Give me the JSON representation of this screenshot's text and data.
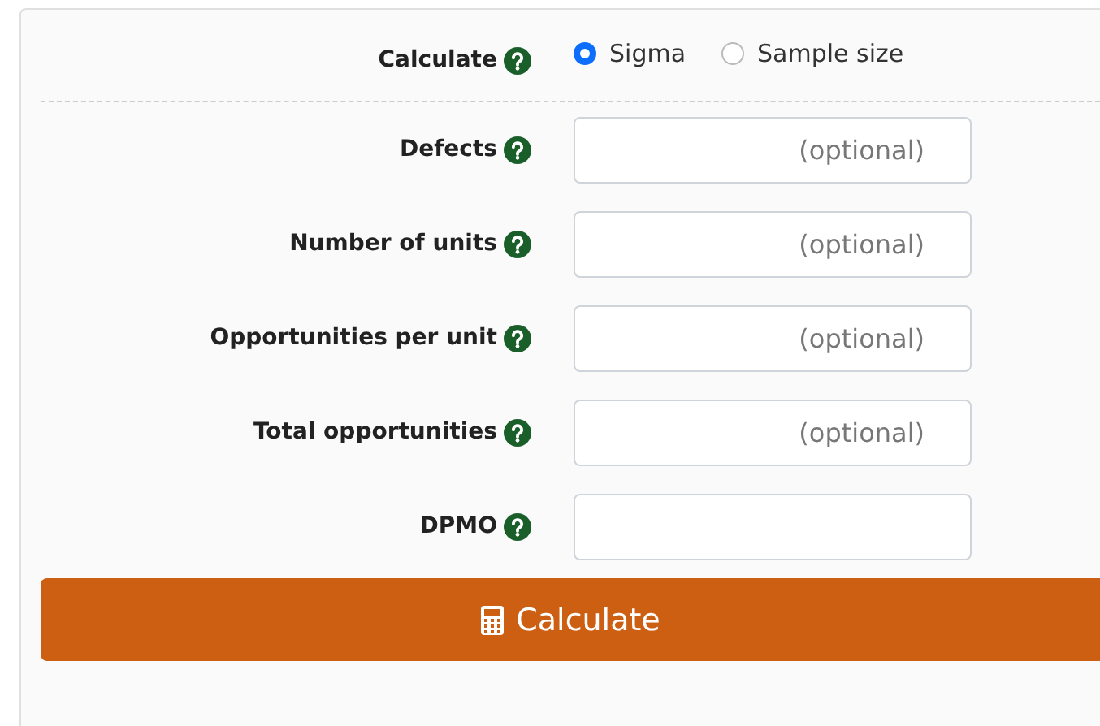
{
  "calculate": {
    "label": "Calculate",
    "options": [
      {
        "label": "Sigma",
        "selected": true
      },
      {
        "label": "Sample size",
        "selected": false
      }
    ]
  },
  "fields": [
    {
      "label": "Defects",
      "placeholder": "(optional)"
    },
    {
      "label": "Number of units",
      "placeholder": "(optional)"
    },
    {
      "label": "Opportunities per unit",
      "placeholder": "(optional)"
    },
    {
      "label": "Total opportunities",
      "placeholder": "(optional)"
    },
    {
      "label": "DPMO"
    }
  ],
  "button": {
    "label": "Calculate"
  }
}
